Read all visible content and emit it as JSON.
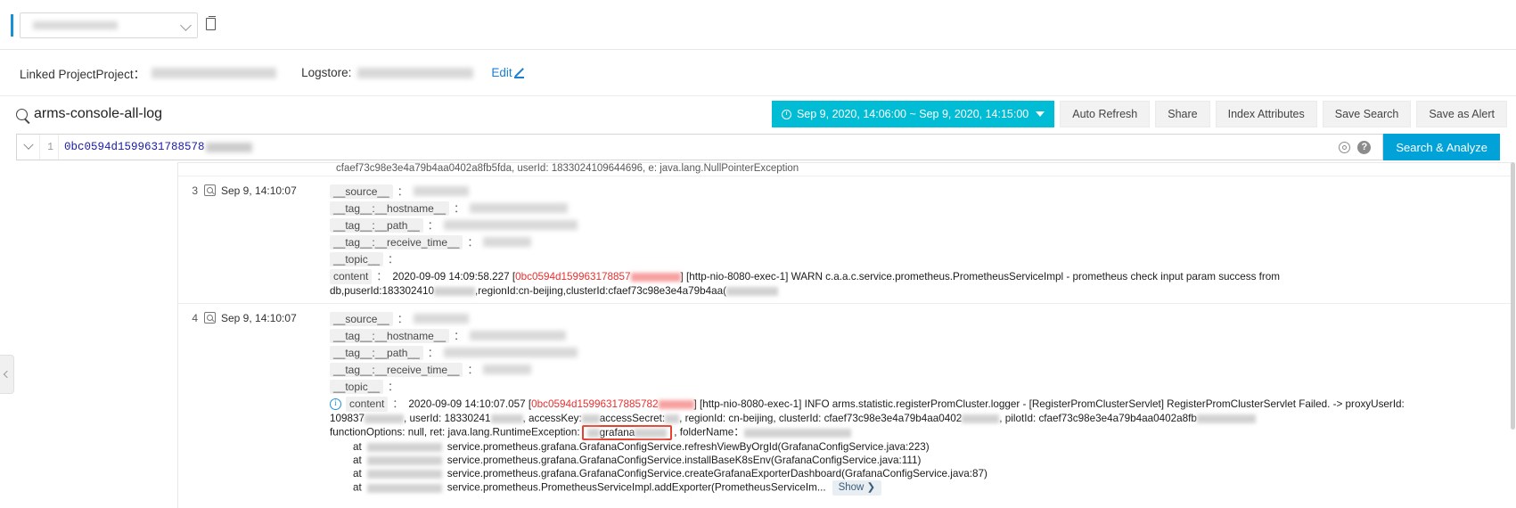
{
  "topbar": {
    "project_selector": {
      "name": "project-selector",
      "value_redacted": true
    },
    "copy_icon": "copy-icon"
  },
  "linked": {
    "project_label": "Linked ProjectProject：",
    "logstore_label": "Logstore:",
    "edit_label": "Edit",
    "edit_icon": "pencil-icon"
  },
  "query_header": {
    "logstore_title": "arms-console-all-log",
    "search_icon": "search-icon",
    "time_range": "Sep 9, 2020, 14:06:00 ~ Sep 9, 2020, 14:15:00",
    "clock_icon": "clock-icon",
    "buttons": [
      "Auto Refresh",
      "Share",
      "Index Attributes",
      "Save Search",
      "Save as Alert"
    ]
  },
  "query_bar": {
    "line_number": "1",
    "query_value": "0bc0594d1599631788578",
    "gear_icon": "gear-icon",
    "help_icon": "help-icon",
    "search_button": "Search & Analyze"
  },
  "clipped_top_line": "cfaef73c98e3e4a79b4aa0402a8fb5fda, userId: 1833024109644696, e: java.lang.NullPointerException",
  "field_keys": {
    "source": "__source__",
    "hostname": "__tag__:__hostname__",
    "path": "__tag__:__path__",
    "receive_time": "__tag__:__receive_time__",
    "topic": "__topic__",
    "content": "content",
    "colon": "："
  },
  "entries": [
    {
      "num": "3",
      "time": "Sep 9, 14:10:07",
      "query_icon": "log-search-icon",
      "content_prefix": "2020-09-09 14:09:58.227 [",
      "content_id": "0bc0594d159963178857",
      "content_mid": "] [http-nio-8080-exec-1] WARN  c.a.a.c.service.prometheus.PrometheusServiceImpl - prometheus check input param success from",
      "content_wrap": "db,puserId:183302410",
      "content_wrap2": ",regionId:cn-beijing,clusterId:cfaef73c98e3e4a79b4aa("
    },
    {
      "num": "4",
      "time": "Sep 9, 14:10:07",
      "query_icon": "log-search-icon",
      "info_icon": "info-icon",
      "content_prefix": "2020-09-09 14:10:07.057 [",
      "content_id": "0bc0594d15996317885782",
      "content_mid": "] [http-nio-8080-exec-1] INFO  arms.statistic.registerPromCluster.logger - [RegisterPromClusterServlet] RegisterPromClusterServlet Failed. -> proxyUserId:",
      "line2_a": "109837",
      "line2_b": ", userId: 18330241",
      "line2_c": ", accessKey:",
      "line2_d": "accessSecret:",
      "line2_e": ", regionId: cn-beijing, clusterId: cfaef73c98e3e4a79b4aa0402",
      "line2_f": ", pilotId: cfaef73c98e3e4a79b4aa0402a8fb",
      "line3_a": "functionOptions: null, ret: java.lang.RuntimeException:",
      "line3_highlight": "grafana",
      "line3_b": ", folderName：",
      "stack": [
        "service.prometheus.grafana.GrafanaConfigService.refreshViewByOrgId(GrafanaConfigService.java:223)",
        "service.prometheus.grafana.GrafanaConfigService.installBaseK8sEnv(GrafanaConfigService.java:111)",
        "service.prometheus.grafana.GrafanaConfigService.createGrafanaExporterDashboard(GrafanaConfigService.java:87)",
        "service.prometheus.PrometheusServiceImpl.addExporter(PrometheusServiceIm..."
      ],
      "stack_prefix": "at",
      "show_button": "Show ❯"
    }
  ]
}
